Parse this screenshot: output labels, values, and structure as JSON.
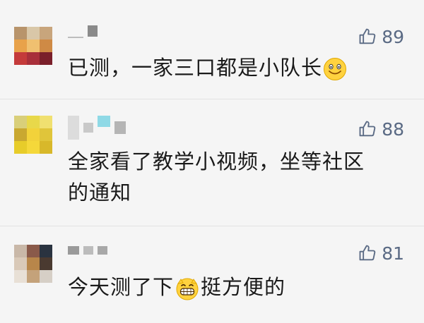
{
  "comments": [
    {
      "likes": "89",
      "text_before": "已测，一家三口都是小队长",
      "emoji": "smile-emoji",
      "text_after": "",
      "text_line2": ""
    },
    {
      "likes": "88",
      "text_before": "全家看了教学小视频，坐等社区",
      "emoji": "",
      "text_after": "",
      "text_line2": "的通知"
    },
    {
      "likes": "81",
      "text_before": "今天测了下",
      "emoji": "grin-emoji",
      "text_after": "挺方便的",
      "text_line2": ""
    }
  ],
  "icons": {
    "like": "thumbs-up-icon"
  },
  "colors": {
    "background": "#f5f5f5",
    "like": "#5a6a84",
    "text": "#1a1a1a"
  }
}
